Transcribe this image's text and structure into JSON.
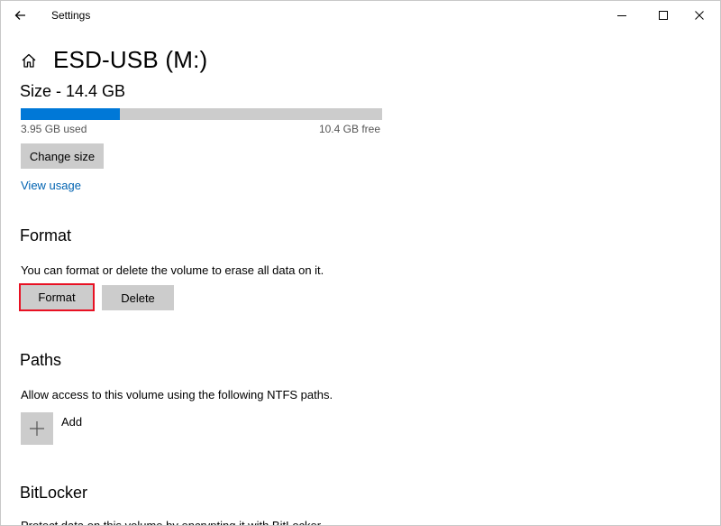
{
  "window": {
    "title": "Settings"
  },
  "header": {
    "title": "ESD-USB (M:)"
  },
  "size": {
    "label": "Size - 14.4 GB",
    "used_label": "3.95 GB used",
    "free_label": "10.4 GB free",
    "used_fraction": 0.274,
    "change_size_label": "Change size",
    "view_usage_label": "View usage"
  },
  "format": {
    "title": "Format",
    "description": "You can format or delete the volume to erase all data on it.",
    "format_label": "Format",
    "delete_label": "Delete"
  },
  "paths": {
    "title": "Paths",
    "description": "Allow access to this volume using the following NTFS paths.",
    "add_label": "Add"
  },
  "bitlocker": {
    "title": "BitLocker",
    "description": "Protect data on this volume by encrypting it with BitLocker."
  },
  "colors": {
    "accent": "#0078d7",
    "link": "#0063b1",
    "highlight": "#e81123",
    "button": "#cccccc"
  },
  "icons": {
    "back": "back-arrow-icon",
    "home": "home-icon",
    "minimize": "minimize-icon",
    "maximize": "maximize-icon",
    "close": "close-icon",
    "add": "plus-icon"
  }
}
